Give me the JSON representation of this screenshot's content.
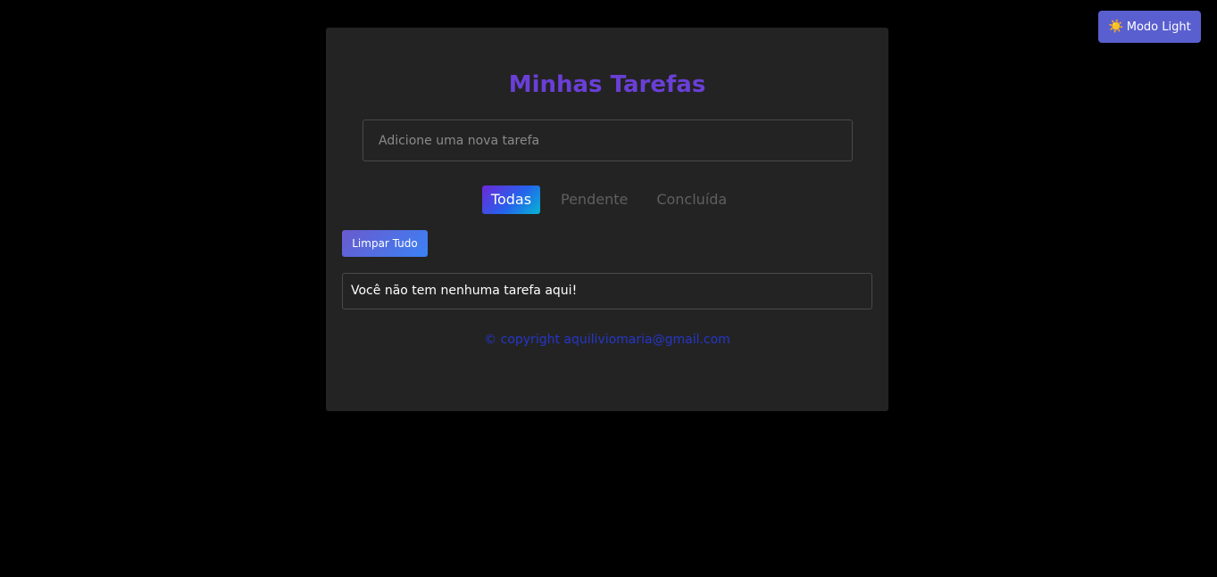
{
  "theme_toggle": {
    "icon": "sun-icon",
    "icon_glyph": "☀️",
    "label": "Modo Light"
  },
  "app": {
    "title": "Minhas Tarefas",
    "input_placeholder": "Adicione uma nova tarefa",
    "input_value": ""
  },
  "filters": {
    "all": "Todas",
    "pending": "Pendente",
    "done": "Concluída",
    "active": "all"
  },
  "clear_all_label": "Limpar Tudo",
  "empty_message": "Você não tem nenhuma tarefa aqui!",
  "footer": "© copyright aquiliviomaria@gmail.com",
  "colors": {
    "page_background": "#000000",
    "card_background": "#232323",
    "title": "#6a3fd6",
    "toggle_background": "#5a5fd0",
    "footer_link": "#2536c9",
    "inactive_filter": "#5f5f5f"
  }
}
